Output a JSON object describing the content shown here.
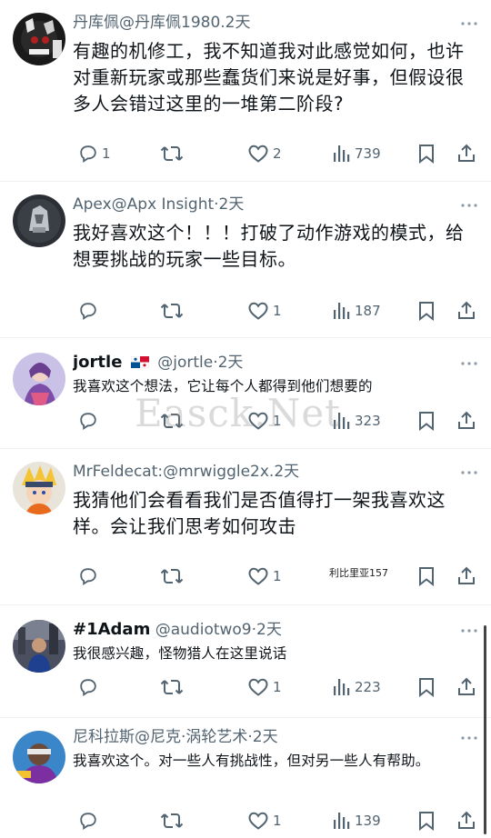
{
  "tweets": [
    {
      "display_name": "丹库佩",
      "handle": "@丹库佩1980",
      "time": ".2天",
      "text": "有趣的机修工，我不知道我对此感觉如何，也许对重新玩家或那些蠢货们来说是好事，但假设很多人会错过这里的一堆第二阶段?",
      "replies": "1",
      "retweets": "",
      "likes": "2",
      "views": "739"
    },
    {
      "display_name": "Apex",
      "handle": "@Apx Insight",
      "time": "·2天",
      "text": "我好喜欢这个！！！打破了动作游戏的模式，给想要挑战的玩家一些目标。",
      "replies": "",
      "retweets": "",
      "likes": "1",
      "views": "187"
    },
    {
      "display_name": "jortle",
      "handle": "@jortle",
      "time": "·2天",
      "text": "我喜欢这个想法，它让每个人都得到他们想要的",
      "replies": "",
      "retweets": "",
      "likes": "1",
      "views": "323"
    },
    {
      "display_name": "MrFeldecat",
      "handle": ":@mrwiggle2x",
      "time": ".2天",
      "text": "我猜他们会看看我们是否值得打一架我喜欢这样。会让我们思考如何攻击",
      "replies": "",
      "retweets": "",
      "likes": "1",
      "views": ""
    },
    {
      "display_name": "#1Adam",
      "handle": "@audiotwo9",
      "time": "·2天",
      "text": "我很感兴趣，怪物猎人在这里说话",
      "replies": "",
      "retweets": "",
      "likes": "1",
      "views": "223"
    },
    {
      "display_name": "尼科拉斯",
      "handle": "@尼克·涡轮艺术",
      "time": "·2天",
      "text": "我喜欢这个。对一些人有挑战性，但对另一些人有帮助。",
      "replies": "",
      "retweets": "",
      "likes": "1",
      "views": "139"
    }
  ],
  "overlay": {
    "watermark": "Easck.Net",
    "stamp": "利比里亚157"
  },
  "colors": {
    "text": "#0f1419",
    "secondary": "#536471",
    "divider": "#eff3f4"
  }
}
